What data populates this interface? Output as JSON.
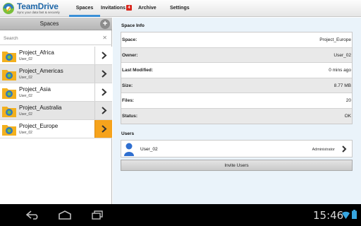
{
  "topbar": {
    "logo_title": "TeamDrive",
    "logo_subtitle": "Sync your data fast & securely",
    "tabs": [
      {
        "label": "Spaces"
      },
      {
        "label": "Invitations"
      },
      {
        "label": "Archive"
      },
      {
        "label": "Settings"
      }
    ],
    "invitations_badge": "4",
    "active_tab": "Spaces",
    "accent_color": "#3a8fd6"
  },
  "spaces_panel": {
    "title": "Spaces",
    "search": {
      "placeholder": "Search",
      "value": ""
    },
    "items": [
      {
        "name": "Project_Africa",
        "owner": "User_02"
      },
      {
        "name": "Project_Americas",
        "owner": "User_02"
      },
      {
        "name": "Project_Asia",
        "owner": "User_02"
      },
      {
        "name": "Project_Australia",
        "owner": "User_02"
      },
      {
        "name": "Project_Europe",
        "owner": "User_02"
      }
    ],
    "selected": "Project_Europe",
    "selected_color": "#f6a31c"
  },
  "space_info": {
    "heading": "Space Info",
    "rows": [
      {
        "key": "Space:",
        "value": "Project_Europe"
      },
      {
        "key": "Owner:",
        "value": "User_02"
      },
      {
        "key": "Last Modified:",
        "value": "0 mins ago"
      },
      {
        "key": "Size:",
        "value": "8.77 MB"
      },
      {
        "key": "Files:",
        "value": "20"
      },
      {
        "key": "Status:",
        "value": "OK"
      }
    ]
  },
  "users": {
    "heading": "Users",
    "list": [
      {
        "name": "User_02",
        "role": "Administrator"
      }
    ],
    "invite_label": "Invite Users"
  },
  "system_bar": {
    "time": "15:46",
    "icons": [
      "back-icon",
      "home-icon",
      "recent-apps-icon",
      "wifi-icon",
      "battery-icon"
    ]
  }
}
